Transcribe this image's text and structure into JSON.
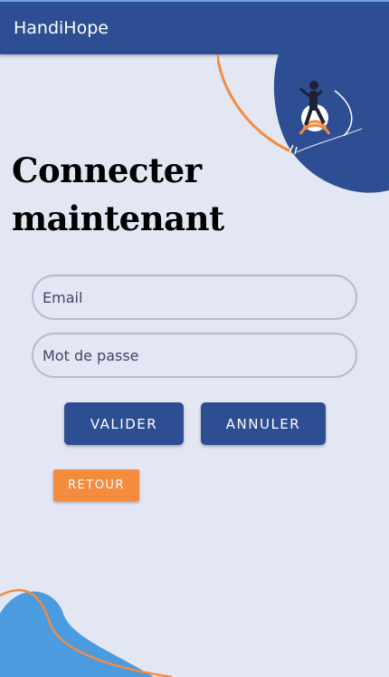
{
  "appbar": {
    "title": "HandiHope"
  },
  "heading": {
    "line1": "Connecter",
    "line2": "maintenant"
  },
  "form": {
    "email_placeholder": "Email",
    "password_placeholder": "Mot de passe"
  },
  "buttons": {
    "validate": "VALIDER",
    "cancel": "ANNULER",
    "back": "RETOUR"
  },
  "colors": {
    "primary": "#2d4e93",
    "accent": "#f58b3f",
    "background": "#e3e6f3",
    "blob_blue": "#4a9be0"
  },
  "decorations": {
    "illustration": "person-wheelchair-illustration"
  }
}
